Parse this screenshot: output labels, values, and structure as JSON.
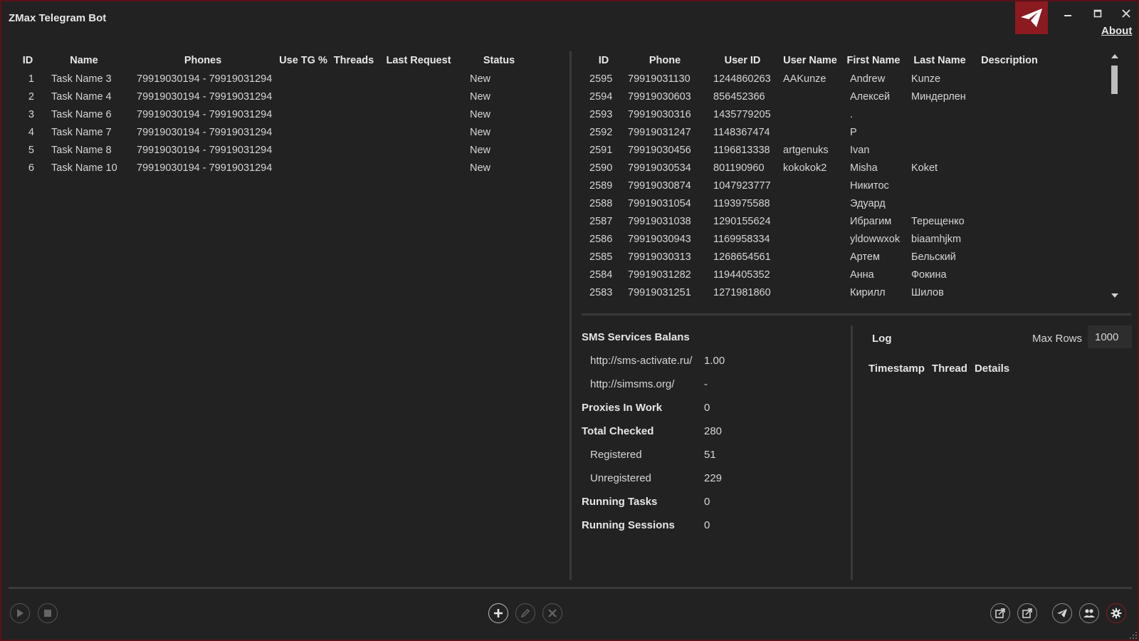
{
  "window": {
    "title": "ZMax Telegram Bot",
    "about": "About",
    "accent": "#8b1a21"
  },
  "tasks": {
    "headers": [
      "ID",
      "Name",
      "Phones",
      "Use TG %",
      "Threads",
      "Last Request",
      "Status"
    ],
    "rows": [
      {
        "id": "1",
        "name": "Task Name 3",
        "phones": "79919030194 - 79919031294",
        "use": "",
        "threads": "",
        "last": "",
        "status": "New"
      },
      {
        "id": "2",
        "name": "Task Name 4",
        "phones": "79919030194 - 79919031294",
        "use": "",
        "threads": "",
        "last": "",
        "status": "New"
      },
      {
        "id": "3",
        "name": "Task Name 6",
        "phones": "79919030194 - 79919031294",
        "use": "",
        "threads": "",
        "last": "",
        "status": "New"
      },
      {
        "id": "4",
        "name": "Task Name 7",
        "phones": "79919030194 - 79919031294",
        "use": "",
        "threads": "",
        "last": "",
        "status": "New"
      },
      {
        "id": "5",
        "name": "Task Name 8",
        "phones": "79919030194 - 79919031294",
        "use": "",
        "threads": "",
        "last": "",
        "status": "New"
      },
      {
        "id": "6",
        "name": "Task Name 10",
        "phones": "79919030194 - 79919031294",
        "use": "",
        "threads": "",
        "last": "",
        "status": "New"
      }
    ]
  },
  "users": {
    "headers": [
      "ID",
      "Phone",
      "User ID",
      "User Name",
      "First Name",
      "Last Name",
      "Description"
    ],
    "rows": [
      {
        "id": "2595",
        "phone": "79919031130",
        "uid": "1244860263",
        "uname": "AAKunze",
        "first": "Andrew",
        "last": "Kunze",
        "desc": ""
      },
      {
        "id": "2594",
        "phone": "79919030603",
        "uid": "856452366",
        "uname": "",
        "first": "Алексей",
        "last": "Миндерлен",
        "desc": ""
      },
      {
        "id": "2593",
        "phone": "79919030316",
        "uid": "1435779205",
        "uname": "",
        "first": ".",
        "last": "",
        "desc": ""
      },
      {
        "id": "2592",
        "phone": "79919031247",
        "uid": "1148367474",
        "uname": "",
        "first": "P",
        "last": "",
        "desc": ""
      },
      {
        "id": "2591",
        "phone": "79919030456",
        "uid": "1196813338",
        "uname": "artgenuks",
        "first": "Ivan",
        "last": "",
        "desc": ""
      },
      {
        "id": "2590",
        "phone": "79919030534",
        "uid": "801190960",
        "uname": "kokokok2",
        "first": "Misha",
        "last": "Koket",
        "desc": ""
      },
      {
        "id": "2589",
        "phone": "79919030874",
        "uid": "1047923777",
        "uname": "",
        "first": "Никитос",
        "last": "",
        "desc": ""
      },
      {
        "id": "2588",
        "phone": "79919031054",
        "uid": "1193975588",
        "uname": "",
        "first": "Эдуард",
        "last": "",
        "desc": ""
      },
      {
        "id": "2587",
        "phone": "79919031038",
        "uid": "1290155624",
        "uname": "",
        "first": "Ибрагим",
        "last": "Терещенко",
        "desc": ""
      },
      {
        "id": "2586",
        "phone": "79919030943",
        "uid": "1169958334",
        "uname": "",
        "first": "yldowwxok",
        "last": "biaamhjkm",
        "desc": ""
      },
      {
        "id": "2585",
        "phone": "79919030313",
        "uid": "1268654561",
        "uname": "",
        "first": "Артем",
        "last": "Бельский",
        "desc": ""
      },
      {
        "id": "2584",
        "phone": "79919031282",
        "uid": "1194405352",
        "uname": "",
        "first": "Анна",
        "last": "Фокина",
        "desc": ""
      },
      {
        "id": "2583",
        "phone": "79919031251",
        "uid": "1271981860",
        "uname": "",
        "first": "Кирилл",
        "last": "Шилов",
        "desc": ""
      }
    ]
  },
  "stats": [
    {
      "label": "SMS Services Balans",
      "value": "",
      "style": "bold"
    },
    {
      "label": "http://sms-activate.ru/",
      "value": "1.00",
      "style": "indent"
    },
    {
      "label": "http://simsms.org/",
      "value": "-",
      "style": "indent"
    },
    {
      "label": "Proxies In Work",
      "value": "0",
      "style": "bold"
    },
    {
      "label": "Total Checked",
      "value": "280",
      "style": "bold"
    },
    {
      "label": "Registered",
      "value": "51",
      "style": "indent"
    },
    {
      "label": "Unregistered",
      "value": "229",
      "style": "indent"
    },
    {
      "label": "Running Tasks",
      "value": "0",
      "style": "bold"
    },
    {
      "label": "Running Sessions",
      "value": "0",
      "style": "bold"
    }
  ],
  "log": {
    "title": "Log",
    "max_rows_label": "Max Rows",
    "max_rows_value": "1000",
    "columns": [
      "Timestamp",
      "Thread",
      "Details"
    ]
  },
  "icons": {
    "play": "play-icon",
    "stop": "stop-icon",
    "add": "plus-icon",
    "edit": "pencil-icon",
    "delete": "x-icon",
    "import": "import-icon",
    "export": "export-icon",
    "telegram": "telegram-icon",
    "users": "users-icon",
    "settings": "gear-icon"
  }
}
